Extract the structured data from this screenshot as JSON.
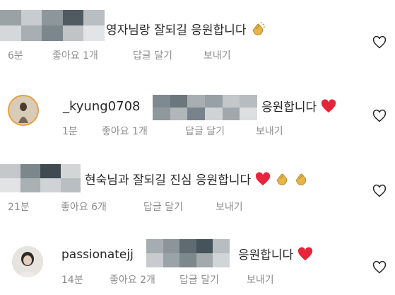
{
  "comments": [
    {
      "text": "영자님랑 잘되길 응원합니다",
      "time": "6분",
      "likes": "좋아요 1개",
      "reply": "답글 달기",
      "send": "보내기"
    },
    {
      "username": "_kyung0708",
      "text": "응원합니다",
      "time": "1분",
      "likes": "좋아요 1개",
      "reply": "답글 달기",
      "send": "보내기"
    },
    {
      "text": "현숙님과 잘되길 진심 응원합니다",
      "time": "21분",
      "likes": "좋아요 6개",
      "reply": "답글 달기",
      "send": "보내기"
    },
    {
      "username": "passionatejj",
      "text": "응원합니다",
      "time": "14분",
      "likes": "좋아요 2개",
      "reply": "답글 달기",
      "send": "보내기"
    }
  ],
  "icons": {
    "like": "heart-outline-icon",
    "heart": "red-heart-emoji",
    "clap": "clapping-hands-emoji"
  },
  "colors": {
    "heart": "#e8243a",
    "meta": "#8e8e8e",
    "clap": "#e6b54a"
  }
}
